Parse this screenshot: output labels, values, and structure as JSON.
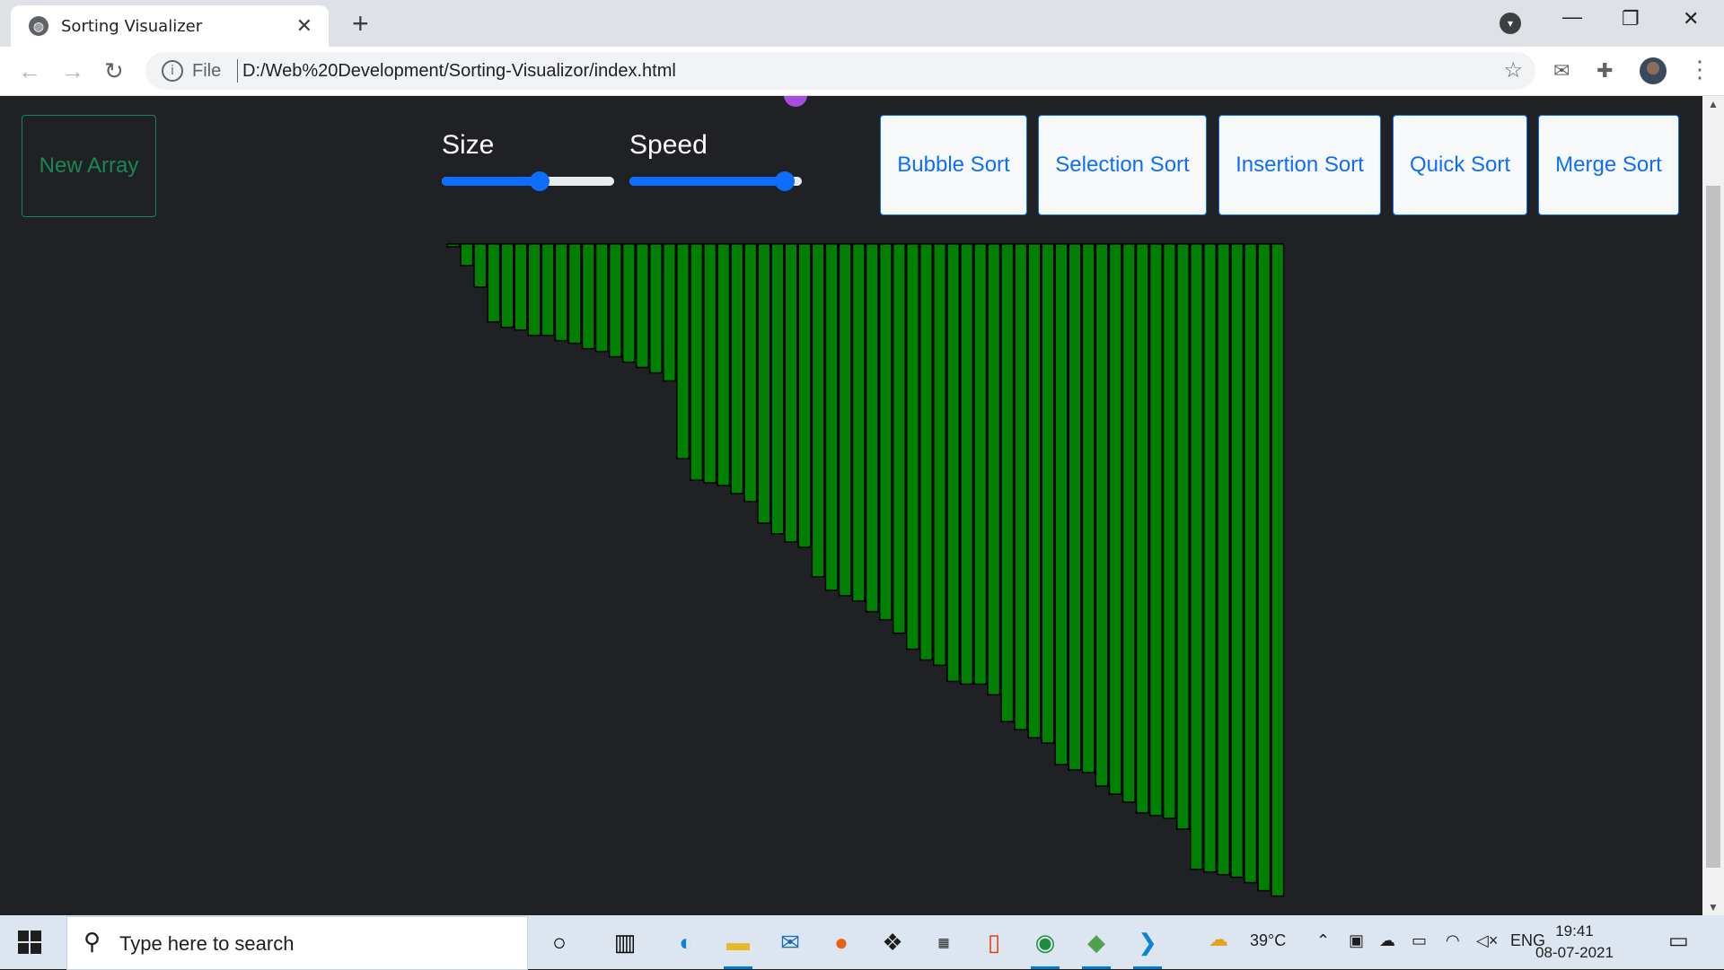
{
  "browser": {
    "tab_title": "Sorting Visualizer",
    "new_tab_symbol": "+",
    "close_symbol": "✕",
    "address_scheme": "File",
    "address_url": "D:/Web%20Development/Sorting-Visualizor/index.html",
    "icons": [
      "globe-icon",
      "back-icon",
      "forward-icon",
      "reload-icon",
      "info-icon",
      "star-icon",
      "mail-icon",
      "extensions-icon",
      "profile-avatar",
      "menu-icon",
      "tab-search-icon",
      "minimize-icon",
      "restore-icon",
      "close-window-icon"
    ]
  },
  "controls": {
    "new_array_label": "New Array",
    "size_label": "Size",
    "speed_label": "Speed",
    "size_value_fraction": 0.57,
    "speed_value_fraction": 0.9,
    "sort_buttons": [
      "Bubble Sort",
      "Selection Sort",
      "Insertion Sort",
      "Quick Sort",
      "Merge Sort"
    ]
  },
  "colors": {
    "bar_fill": "#008000",
    "bar_border": "#000000",
    "page_bg": "#202124",
    "accent_blue": "#0d6efd",
    "success_green": "#198754"
  },
  "chart_data": {
    "type": "bar",
    "title": "",
    "xlabel": "",
    "ylabel": "",
    "orientation": "downward-from-top",
    "categories": [],
    "values": [
      1,
      8,
      16,
      29,
      31,
      32,
      34,
      34,
      36,
      37,
      39,
      40,
      42,
      44,
      46,
      48,
      51,
      80,
      88,
      89,
      90,
      93,
      96,
      104,
      108,
      111,
      113,
      124,
      129,
      131,
      133,
      137,
      140,
      145,
      151,
      155,
      157,
      163,
      164,
      164,
      168,
      178,
      181,
      184,
      186,
      194,
      196,
      197,
      202,
      205,
      208,
      212,
      213,
      214,
      218,
      233,
      234,
      235,
      236,
      238,
      241,
      243
    ]
  },
  "taskbar": {
    "search_placeholder": "Type here to search",
    "weather": "39°C",
    "language": "ENG",
    "time": "19:41",
    "date": "08-07-2021",
    "apps": [
      "cortana-icon",
      "task-view-icon",
      "edge-icon",
      "file-explorer-icon",
      "mail-app-icon",
      "firefox-icon",
      "dropbox-icon",
      "amazon-icon",
      "office-icon",
      "chrome-icon",
      "git-icon",
      "vscode-icon"
    ]
  }
}
